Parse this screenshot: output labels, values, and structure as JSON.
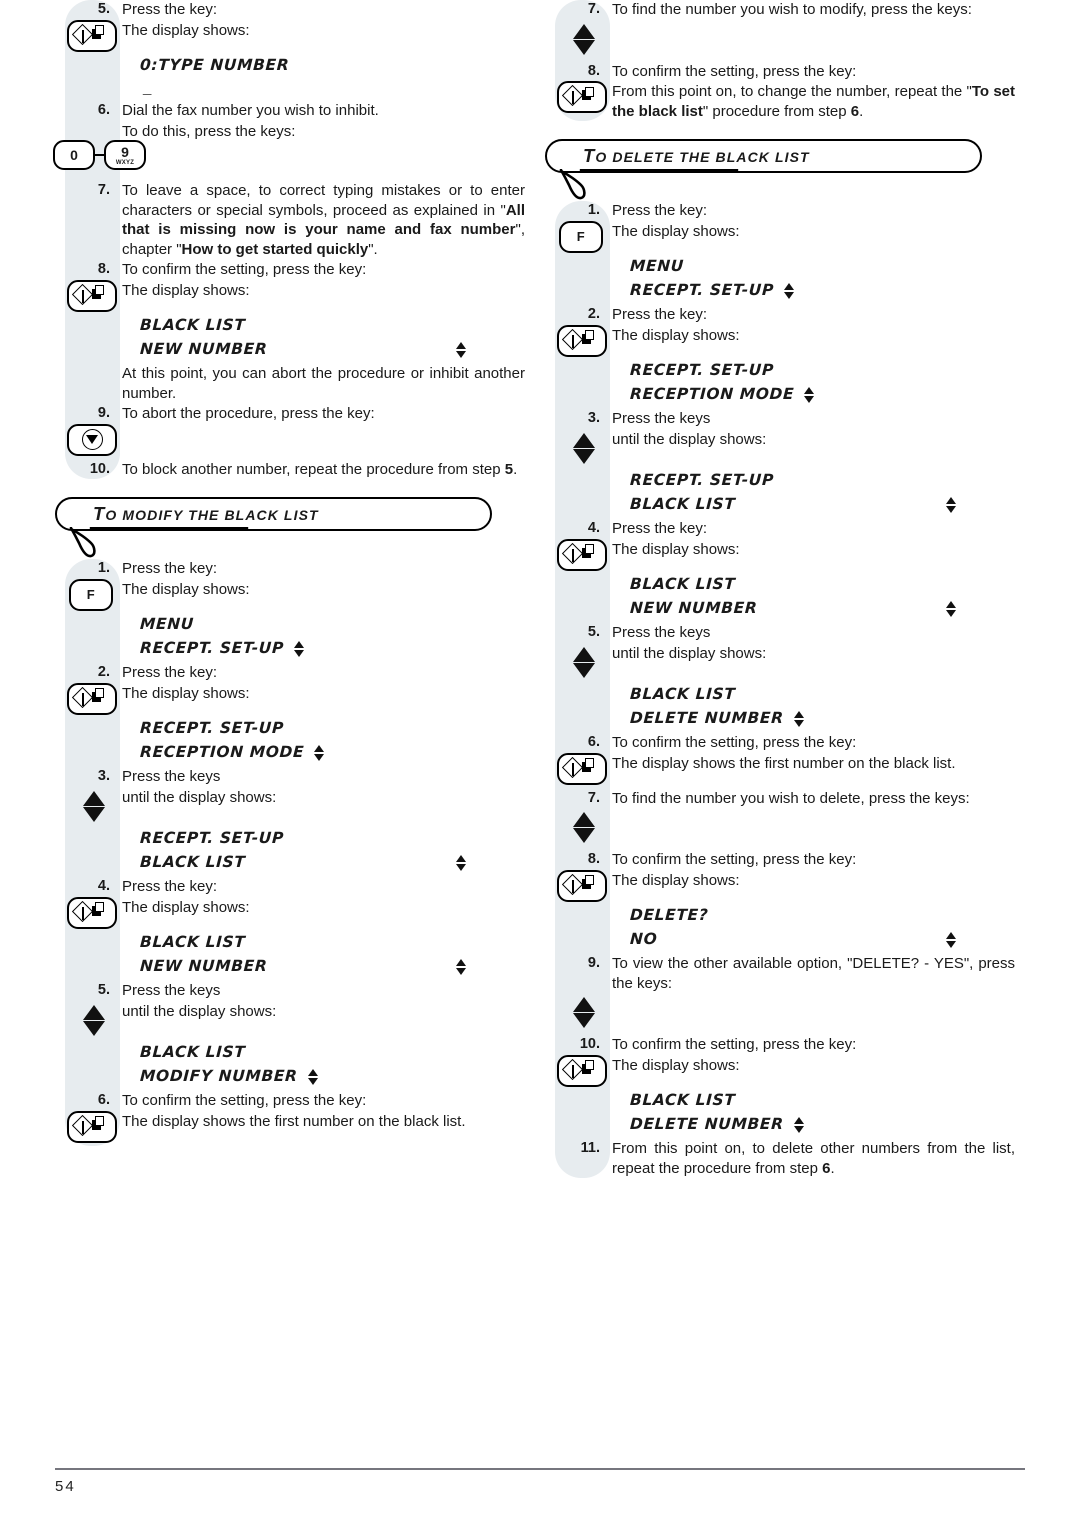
{
  "page": {
    "number": "54"
  },
  "left_column": {
    "block_set": {
      "steps": [
        {
          "num": "5.",
          "text": "Press the key:"
        },
        {
          "key": "start-copy-key",
          "text": "The display shows:"
        },
        {
          "lcd": "0:TYPE NUMBER"
        },
        {
          "cursor": "_"
        },
        {
          "num": "6.",
          "text": "Dial the fax number you wish to inhibit."
        },
        {
          "text": "To do this, press the keys:"
        },
        {
          "keys": "0-9wxyz"
        },
        {
          "num": "7.",
          "html": "To leave a space, to correct typing mistakes or to enter characters or special symbols, proceed as explained in \"<b>All that is missing now is your name and fax number</b>\", chapter \"<b>How to get started quickly</b>\"."
        },
        {
          "num": "8.",
          "text": "To confirm the setting, press the key:"
        },
        {
          "key": "start-copy-key",
          "text": "The display shows:"
        },
        {
          "lcd": "BLACK LIST"
        },
        {
          "lcd": "NEW NUMBER",
          "arrow": true
        },
        {
          "text": "At this point, you can abort the procedure or inhibit another number."
        },
        {
          "num": "9.",
          "text": "To abort the procedure, press the key:"
        },
        {
          "key": "stop-key"
        },
        {
          "num": "10.",
          "html": "To block another number, repeat the procedure from step <b>5</b>."
        }
      ]
    },
    "banner_modify": {
      "first": "T",
      "rest": "O MODIFY THE BLACK LIST"
    },
    "block_modify": {
      "steps": [
        {
          "num": "1.",
          "text": "Press the key:"
        },
        {
          "key": "f-key",
          "text": "The display shows:"
        },
        {
          "lcd": "MENU"
        },
        {
          "lcd": "RECEPT. SET-UP",
          "arrow": true,
          "tight": true
        },
        {
          "num": "2.",
          "text": "Press the key:"
        },
        {
          "key": "start-copy-key",
          "text": "The display shows:"
        },
        {
          "lcd": "RECEPT. SET-UP"
        },
        {
          "lcd": "RECEPTION MODE",
          "arrow": true,
          "tight": true
        },
        {
          "num": "3.",
          "text": "Press the keys"
        },
        {
          "key": "up-down-keys",
          "text": "until the display shows:"
        },
        {
          "lcd": "RECEPT. SET-UP"
        },
        {
          "lcd": "BLACK LIST",
          "arrow": true
        },
        {
          "num": "4.",
          "text": "Press the key:"
        },
        {
          "key": "start-copy-key",
          "text": "The display shows:"
        },
        {
          "lcd": "BLACK LIST"
        },
        {
          "lcd": "NEW NUMBER",
          "arrow": true
        },
        {
          "num": "5.",
          "text": "Press the keys"
        },
        {
          "key": "up-down-keys",
          "text": "until the display shows:"
        },
        {
          "lcd": "BLACK LIST"
        },
        {
          "lcd": "MODIFY NUMBER",
          "arrow": true,
          "tight": true
        },
        {
          "num": "6.",
          "text": "To confirm the setting, press the key:"
        },
        {
          "key": "start-copy-key",
          "text": "The display shows the first number on the black list."
        }
      ]
    }
  },
  "right_column": {
    "block_modify_cont": {
      "steps": [
        {
          "num": "7.",
          "text": "To find the number you wish to modify, press the keys:"
        },
        {
          "key": "up-down-keys"
        },
        {
          "num": "8.",
          "text": "To confirm the setting, press the key:"
        },
        {
          "key": "start-copy-key",
          "html": "From this point on, to change the number, repeat the \"<b>To set the black list</b>\" procedure from step <b>6</b>."
        }
      ]
    },
    "banner_delete": {
      "first": "T",
      "rest": "O DELETE THE BLACK LIST"
    },
    "block_delete": {
      "steps": [
        {
          "num": "1.",
          "text": "Press the key:"
        },
        {
          "key": "f-key",
          "text": "The display shows:"
        },
        {
          "lcd": "MENU"
        },
        {
          "lcd": "RECEPT. SET-UP",
          "arrow": true,
          "tight": true
        },
        {
          "num": "2.",
          "text": "Press the key:"
        },
        {
          "key": "start-copy-key",
          "text": "The display shows:"
        },
        {
          "lcd": "RECEPT. SET-UP"
        },
        {
          "lcd": "RECEPTION MODE",
          "arrow": true,
          "tight": true
        },
        {
          "num": "3.",
          "text": "Press the keys"
        },
        {
          "key": "up-down-keys",
          "text": "until the display shows:"
        },
        {
          "lcd": "RECEPT. SET-UP"
        },
        {
          "lcd": "BLACK LIST",
          "arrow": true
        },
        {
          "num": "4.",
          "text": "Press the key:"
        },
        {
          "key": "start-copy-key",
          "text": "The display shows:"
        },
        {
          "lcd": "BLACK LIST"
        },
        {
          "lcd": "NEW NUMBER",
          "arrow": true
        },
        {
          "num": "5.",
          "text": "Press the keys"
        },
        {
          "key": "up-down-keys",
          "text": "until the display shows:"
        },
        {
          "lcd": "BLACK LIST"
        },
        {
          "lcd": "DELETE NUMBER",
          "arrow": true,
          "tight": true
        },
        {
          "num": "6.",
          "text": "To confirm the setting, press the key:"
        },
        {
          "key": "start-copy-key",
          "text": "The display shows the first number on the black list."
        },
        {
          "num": "7.",
          "text": "To find the number you wish to delete, press the keys:"
        },
        {
          "key": "up-down-keys"
        },
        {
          "num": "8.",
          "text": "To confirm the setting, press the key:"
        },
        {
          "key": "start-copy-key",
          "text": "The display shows:"
        },
        {
          "lcd": "DELETE?"
        },
        {
          "lcd": "NO",
          "arrow": true
        },
        {
          "num": "9.",
          "text": "To view the other available option, \"DELETE? - YES\", press the keys:"
        },
        {
          "key": "up-down-keys"
        },
        {
          "num": "10.",
          "text": "To confirm the setting, press the key:"
        },
        {
          "key": "start-copy-key",
          "text": "The display shows:"
        },
        {
          "lcd": "BLACK LIST"
        },
        {
          "lcd": "DELETE NUMBER",
          "arrow": true,
          "tight": true
        },
        {
          "num": "11.",
          "html": "From this point on, to delete other numbers from the list, repeat the procedure from step <b>6</b>."
        }
      ]
    }
  },
  "keys": {
    "start_copy_label": "start-copy-key",
    "stop_label": "stop-key",
    "f_label": "F",
    "numeric_zero": "0",
    "numeric_nine": "9",
    "numeric_nine_sub": "WXYZ"
  },
  "colors": {
    "strip": "#e7ecef",
    "rule": "#76767e",
    "ink": "#1a1a1a"
  }
}
